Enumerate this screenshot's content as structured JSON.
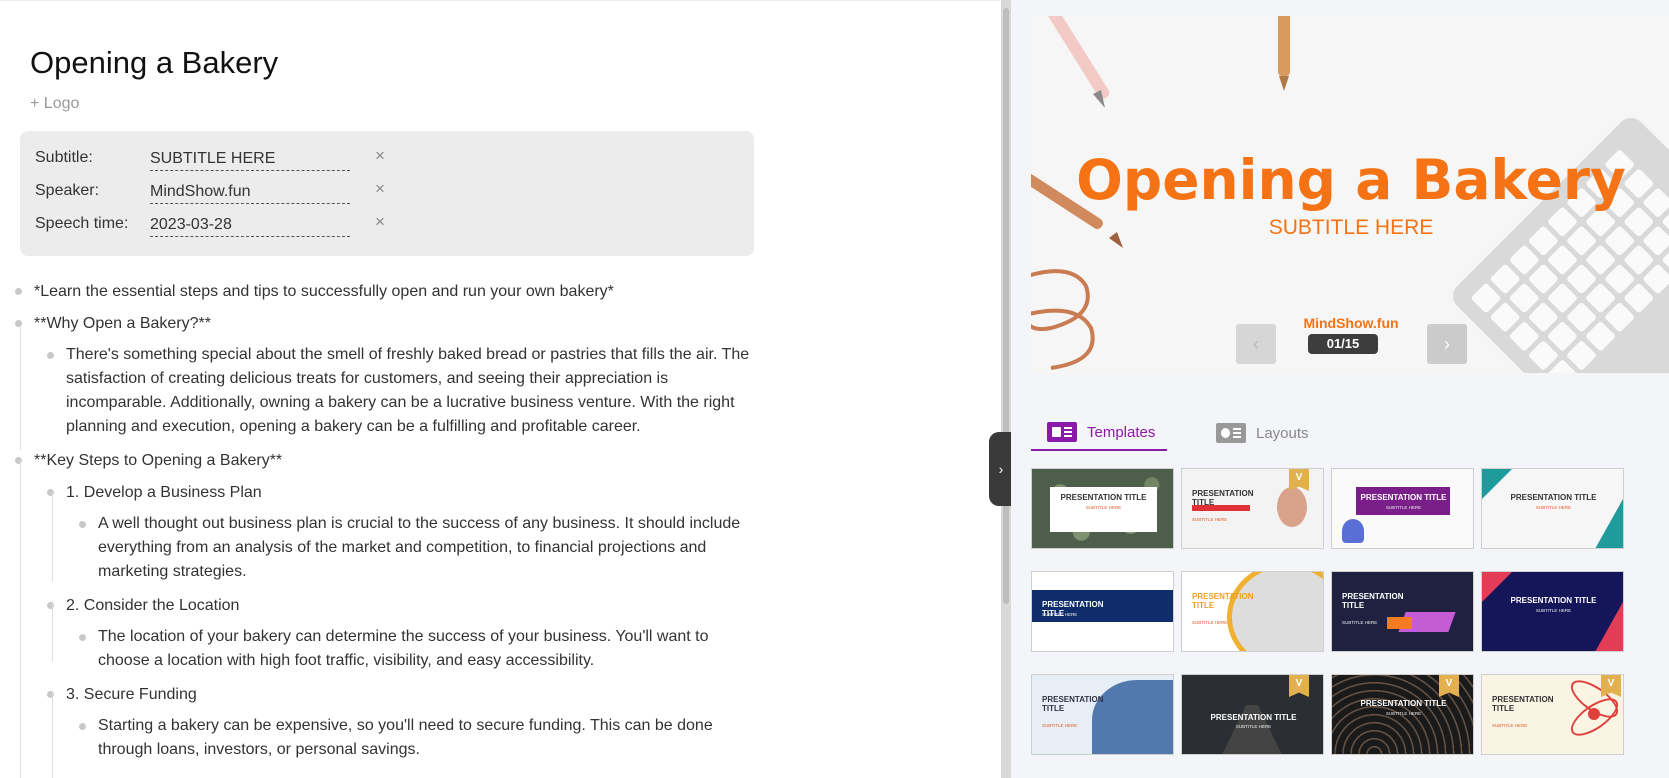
{
  "document": {
    "title": "Opening a Bakery",
    "add_logo": "+ Logo",
    "meta": {
      "subtitle_label": "Subtitle:",
      "subtitle_value": "SUBTITLE HERE",
      "speaker_label": "Speaker:",
      "speaker_value": "MindShow.fun",
      "time_label": "Speech time:",
      "time_value": "2023-03-28",
      "clear_symbol": "×"
    },
    "outline": [
      {
        "level": 1,
        "text": "*Learn the essential steps and tips to successfully open and run your own bakery*"
      },
      {
        "level": 1,
        "text": "**Why Open a Bakery?**"
      },
      {
        "level": 2,
        "lines": [
          "There's something special about the smell of freshly baked bread or pastries that fills the air. The",
          "satisfaction of creating delicious treats for customers, and seeing their appreciation is",
          "incomparable. Additionally, owning a bakery can be a lucrative business venture. With the right",
          "planning and execution, opening a bakery can be a fulfilling and profitable career."
        ]
      },
      {
        "level": 1,
        "text": "**Key Steps to Opening a Bakery**"
      },
      {
        "level": 2,
        "text": "1. Develop a Business Plan"
      },
      {
        "level": 3,
        "lines": [
          "A well thought out business plan is crucial to the success of any business. It should include",
          "everything from an analysis of the market and competition, to financial projections and",
          "marketing strategies."
        ]
      },
      {
        "level": 2,
        "text": "2. Consider the Location"
      },
      {
        "level": 3,
        "lines": [
          "The location of your bakery can determine the success of your business. You'll want to",
          "choose a location with high foot traffic, visibility, and easy accessibility."
        ]
      },
      {
        "level": 2,
        "text": "3. Secure Funding"
      },
      {
        "level": 3,
        "lines": [
          "Starting a bakery can be expensive, so you'll need to secure funding. This can be done",
          "through loans, investors, or personal savings."
        ]
      }
    ]
  },
  "panel": {
    "collapse_symbol": "›",
    "preview": {
      "title": "Opening a Bakery",
      "subtitle": "SUBTITLE HERE",
      "speaker": "MindShow.fun",
      "counter": "01/15",
      "prev_symbol": "‹",
      "next_symbol": "›"
    },
    "tabs": [
      {
        "label": "Templates",
        "active": true
      },
      {
        "label": "Layouts",
        "active": false
      }
    ],
    "templates": [
      {
        "title": "PRESENTATION TITLE",
        "sub": "SUBTITLE HERE",
        "vip": false
      },
      {
        "title": "PRESENTATION TITLE",
        "sub": "SUBTITLE HERE",
        "vip": true
      },
      {
        "title": "PRESENTATION TITLE",
        "sub": "SUBTITLE HERE",
        "vip": false
      },
      {
        "title": "PRESENTATION TITLE",
        "sub": "SUBTITLE HERE",
        "vip": false
      },
      {
        "title": "PRESENTATION TITLE",
        "sub": "SUBTITLE HERE",
        "vip": false
      },
      {
        "title": "PRESENTATION TITLE",
        "sub": "SUBTITLE HERE",
        "vip": false
      },
      {
        "title": "PRESENTATION TITLE",
        "sub": "SUBTITLE HERE",
        "vip": false
      },
      {
        "title": "PRESENTATION TITLE",
        "sub": "SUBTITLE HERE",
        "vip": false
      },
      {
        "title": "PRESENTATION TITLE",
        "sub": "SUBTITLE HERE",
        "vip": false
      },
      {
        "title": "PRESENTATION TITLE",
        "sub": "SUBTITLE HERE",
        "vip": true
      },
      {
        "title": "PRESENTATION TITLE",
        "sub": "SUBTITLE HERE",
        "vip": true
      },
      {
        "title": "PRESENTATION TITLE",
        "sub": "SUBTITLE HERE",
        "vip": true
      }
    ],
    "vip_badge": "V"
  }
}
